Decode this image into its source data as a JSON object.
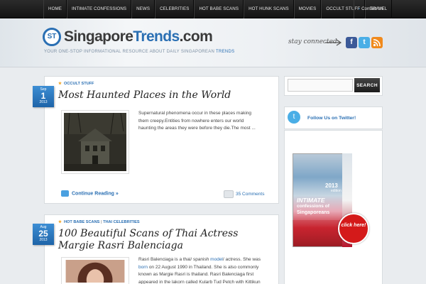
{
  "nav": {
    "items": [
      "HOME",
      "INTIMATE CONFESSIONS",
      "NEWS",
      "CELEBRITIES",
      "HOT BABE SCANS",
      "HOT HUNK SCANS",
      "MOVIES",
      "OCCULT STUFF",
      "TRAVEL"
    ],
    "contact": "Contact Us"
  },
  "header": {
    "logo_mark": "ST",
    "logo_part1": "Singapore",
    "logo_part2": "Trends",
    "logo_part3": ".com",
    "tagline": "YOUR ONE-STOP INFORMATIONAL RESOURCE ABOUT DAILY SINGAPOREAN",
    "tagline_highlight": "TRENDS",
    "stay_connected": "stay connected",
    "social_icons": [
      "facebook-icon",
      "twitter-icon",
      "rss-icon"
    ]
  },
  "posts": [
    {
      "date_month": "Sep",
      "date_day": "1",
      "date_year": "2013",
      "categories": [
        "OCCULT STUFF"
      ],
      "title": "Most Haunted Places in the World",
      "excerpt": "Supernatural phenomena occur in these places making them creepy.Entities from nowhere enters our world haunting the areas they were before they die.The most ...",
      "continue_label": "Continue Reading »",
      "comments_label": "35 Comments"
    },
    {
      "date_month": "Aug",
      "date_day": "25",
      "date_year": "2013",
      "categories": [
        "HOT BABE SCANS",
        "THAI CELEBRITIES"
      ],
      "title": "100 Beautiful Scans of Thai Actress Margie Rasri Balenciaga",
      "excerpt_1": "Rasri Balenciaga is a thai/ spanish ",
      "excerpt_link_1": "model",
      "excerpt_2": "/ actress. She was ",
      "excerpt_link_2": "born",
      "excerpt_3": " on 22 August 1990 in Thailand. She is also commonly known as Margie Rasri is thailand. Rasri Balenciaga first appeared in the lakorn called Kularb Tud Petch with Kittikun"
    }
  ],
  "sidebar": {
    "search_placeholder": "",
    "search_button": "SEARCH",
    "twitter_label": "Follow Us on Twitter!",
    "ad": {
      "year": "2013",
      "edition": "edition",
      "title_1": "INTIMATE",
      "title_2": "confessions of",
      "title_3": "Singaporeans",
      "click_label": "click here!"
    }
  },
  "colors": {
    "accent": "#2a6fb3",
    "nav_bg": "#1c1c1c",
    "page_bg": "#e9ecef"
  }
}
